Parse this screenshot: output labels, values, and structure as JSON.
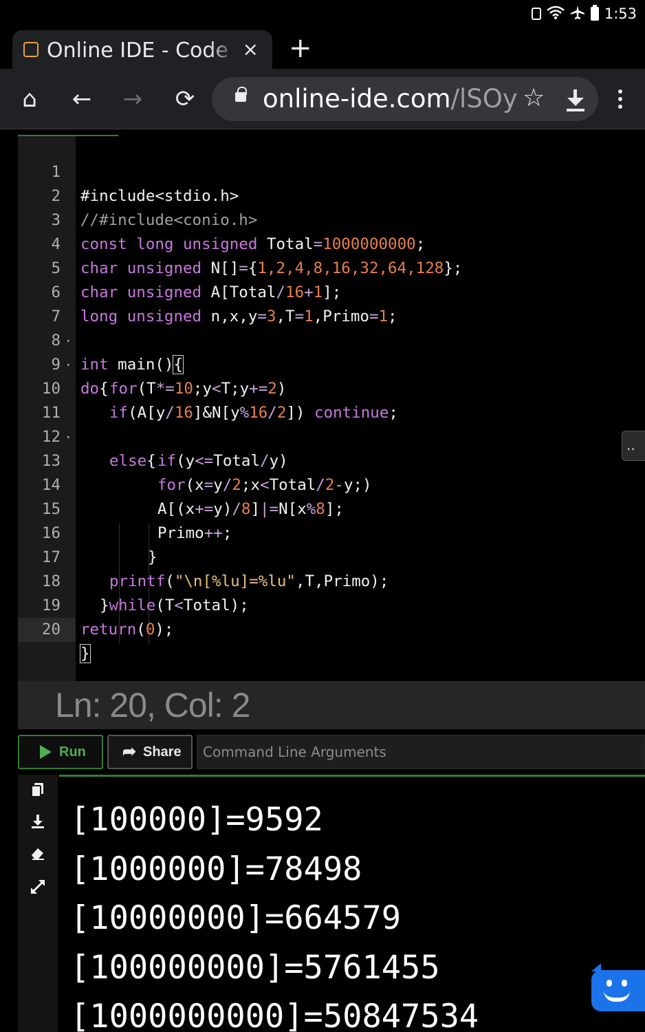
{
  "status_bar": {
    "time": "1:53"
  },
  "tab": {
    "title": "Online IDE - Code Editor",
    "close": "×",
    "new_tab": "+"
  },
  "toolbar": {
    "home": "⌂",
    "back": "←",
    "forward": "→",
    "reload": "⟳",
    "star": "☆",
    "menu": "⋮"
  },
  "omnibox": {
    "domain": "online-ide.com",
    "path": "/lSOyW"
  },
  "editor": {
    "lines": [
      {
        "n": "1"
      },
      {
        "n": "2"
      },
      {
        "n": "3"
      },
      {
        "n": "4"
      },
      {
        "n": "5"
      },
      {
        "n": "6"
      },
      {
        "n": "7"
      },
      {
        "n": "8"
      },
      {
        "n": "9"
      },
      {
        "n": "10"
      },
      {
        "n": "11"
      },
      {
        "n": "12"
      },
      {
        "n": "13"
      },
      {
        "n": "14"
      },
      {
        "n": "15"
      },
      {
        "n": "16"
      },
      {
        "n": "17"
      },
      {
        "n": "18"
      },
      {
        "n": "19"
      },
      {
        "n": "20"
      }
    ],
    "code": {
      "l1": "#include<stdio.h>",
      "l2": "//#include<conio.h>",
      "l3a": "const long unsigned",
      "l3b": " Total",
      "l3c": "=",
      "l3d": "1000000000",
      "l3e": ";",
      "l4a": "char unsigned",
      "l4b": " N[]",
      "l4c": "=",
      "l4d": "{",
      "l4e": "1,2,4,8,16,32,64,128",
      "l4f": "};",
      "l5a": "char unsigned",
      "l5b": " A[Total",
      "l5c": "/",
      "l5d": "16",
      "l5e": "+",
      "l5f": "1",
      "l5g": "];",
      "l6a": "long unsigned",
      "l6b": " n,x,y",
      "l6c": "=",
      "l6d": "3",
      "l6e": ",T",
      "l6f": "=",
      "l6g": "1",
      "l6h": ",Primo",
      "l6i": "=",
      "l6j": "1",
      "l6k": ";",
      "l7a": "int",
      "l7b": " main()",
      "l7c": "{",
      "l8a": "do",
      "l8b": "{",
      "l9a": "for",
      "l9b": "(T",
      "l9c": "*=",
      "l9d": "10",
      "l9e": ";y",
      "l9f": "<",
      "l9g": "T;y",
      "l9h": "+=",
      "l9i": "2",
      "l9j": ")",
      "l10a": "if",
      "l10b": "(A[y",
      "l10c": "/",
      "l10d": "16",
      "l10e": "]&N[y",
      "l10f": "%",
      "l10g": "16",
      "l10h": "/",
      "l10i": "2",
      "l10j": "]) ",
      "l10k": "continue",
      "l10l": ";",
      "l11a": "else",
      "l11b": "{",
      "l12a": "if",
      "l12b": "(y",
      "l12c": "<=",
      "l12d": "Total",
      "l12e": "/",
      "l12f": "y)",
      "l13a": "for",
      "l13b": "(x",
      "l13c": "=",
      "l13d": "y",
      "l13e": "/",
      "l13f": "2",
      "l13g": ";x",
      "l13h": "<",
      "l13i": "Total",
      "l13j": "/",
      "l13k": "2",
      "l13l": "-",
      "l13m": "y;)",
      "l14a": "A[(x",
      "l14b": "+=",
      "l14c": "y)",
      "l14d": "/",
      "l14e": "8",
      "l14f": "]",
      "l14g": "|=",
      "l14h": "N[x",
      "l14i": "%",
      "l14j": "8",
      "l14k": "];",
      "l15a": "Primo",
      "l15b": "++",
      "l15c": ";",
      "l16": "}",
      "l17a": "printf",
      "l17b": "(",
      "l17c": "\"\\n[%lu]=%lu\"",
      "l17d": ",T,Primo);",
      "l18a": "}",
      "l18b": "while",
      "l18c": "(T",
      "l18d": "<",
      "l18e": "Total);",
      "l19a": "return",
      "l19b": "(",
      "l19c": "0",
      "l19d": ");",
      "l20": "}"
    }
  },
  "side_button": "..",
  "position": {
    "text": "Ln: 20,  Col: 2"
  },
  "controls": {
    "run": "Run",
    "share": "Share",
    "args_placeholder": "Command Line Arguments"
  },
  "output": {
    "text": "[100000]=9592\n[1000000]=78498\n[10000000]=664579\n[100000000]=5761455\n[1000000000]=50847534"
  }
}
